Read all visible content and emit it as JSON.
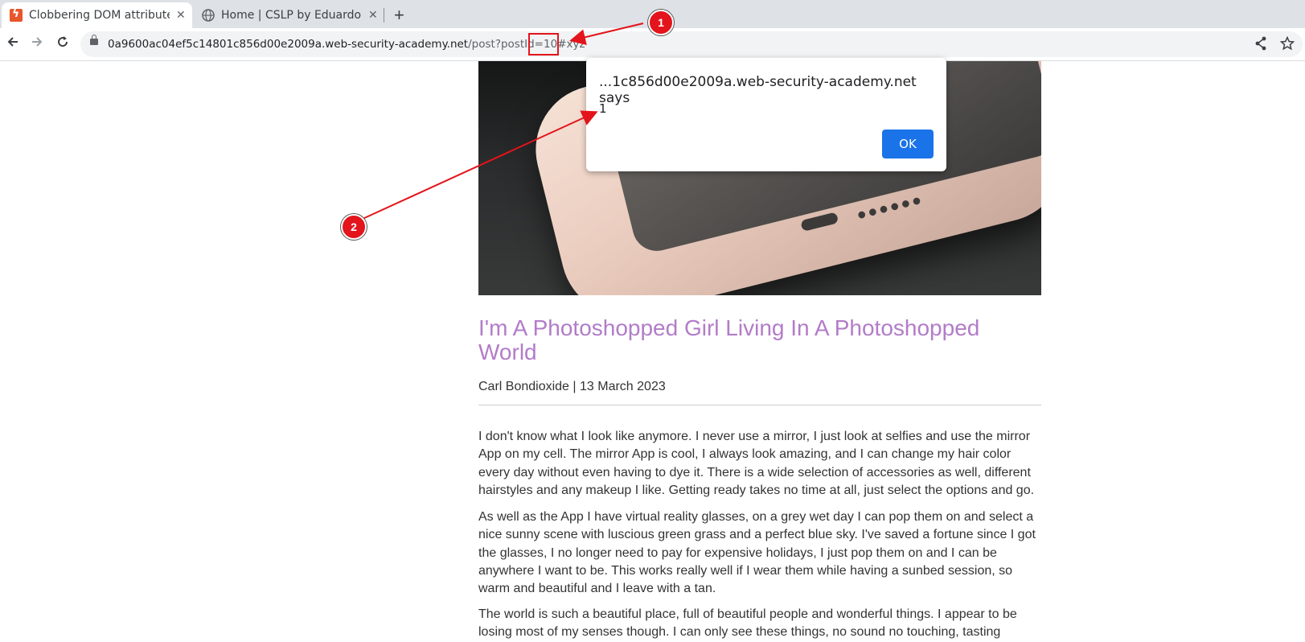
{
  "browser": {
    "tabs": [
      {
        "title": "Clobbering DOM attributes to bypass HTML filters",
        "close": "✕"
      },
      {
        "title": "Home | CSLP by EduardoD",
        "close": "✕"
      }
    ],
    "new_tab": "+",
    "url_host": "0a9600ac04ef5c14801c856d00e2009a.web-security-academy.net",
    "url_path": "/post?postId=10",
    "url_fragment": "#xyz"
  },
  "annotations": {
    "badge1": "1",
    "badge2": "2",
    "color": "#e3141b"
  },
  "dialog": {
    "title": "...1c856d00e2009a.web-security-academy.net says",
    "message": "1",
    "ok_label": "OK"
  },
  "post": {
    "title": "I'm A Photoshopped Girl Living In A Photoshopped World",
    "meta": "Carl Bondioxide | 13 March 2023",
    "paragraphs": [
      "I don't know what I look like anymore. I never use a mirror, I just look at selfies and use the mirror App on my cell. The mirror App is cool, I always look amazing, and I can change my hair color every day without even having to dye it. There is a wide selection of accessories as well, different hairstyles and any makeup I like. Getting ready takes no time at all, just select the options and go.",
      "As well as the App I have virtual reality glasses, on a grey wet day I can pop them on and select a nice sunny scene with luscious green grass and a perfect blue sky. I've saved a fortune since I got the glasses, I no longer need to pay for expensive holidays, I just pop them on and I can be anywhere I want to be. This works really well if I wear them while having a sunbed session, so warm and beautiful and I leave with a tan.",
      "The world is such a beautiful place, full of beautiful people and wonderful things. I appear to be losing most of my senses though. I can only see these things, no sound no touching, tasting"
    ],
    "title_color": "#b27cc8"
  },
  "icons": {
    "back": "back-arrow-icon",
    "forward": "forward-arrow-icon",
    "reload": "reload-icon",
    "share": "share-icon",
    "bookmark": "star-icon"
  }
}
